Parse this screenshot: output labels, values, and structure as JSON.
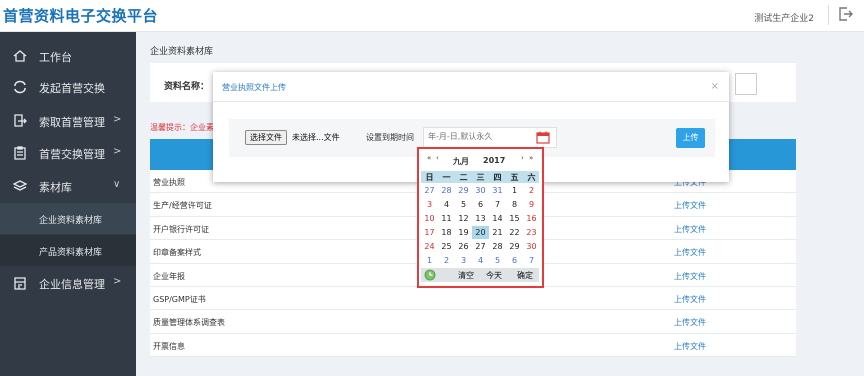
{
  "header": {
    "title": "首营资料电子交换平台",
    "user": "测试生产企业2"
  },
  "sidebar": {
    "items": [
      {
        "label": "工作台",
        "icon": "home-icon"
      },
      {
        "label": "发起首营交换",
        "icon": "exchange-icon"
      },
      {
        "label": "索取首营管理",
        "icon": "request-icon",
        "chevron": ">"
      },
      {
        "label": "首营交换管理",
        "icon": "clipboard-icon",
        "chevron": ">"
      },
      {
        "label": "素材库",
        "icon": "layers-icon",
        "chevron": "∨"
      },
      {
        "label": "企业资料素材库",
        "sub": true
      },
      {
        "label": "产品资料素材库",
        "sub": true
      },
      {
        "label": "企业信息管理",
        "icon": "building-icon",
        "chevron": ">"
      }
    ]
  },
  "main": {
    "breadcrumb": "企业资料素材库",
    "filter_label": "资料名称：",
    "hint": "温馨提示：企业素",
    "rows": [
      {
        "name": "营业执照",
        "action": "上传文件"
      },
      {
        "name": "生产/经营许可证",
        "action": "上传文件"
      },
      {
        "name": "开户银行许可证",
        "action": "上传文件"
      },
      {
        "name": "印章备案样式",
        "action": "上传文件"
      },
      {
        "name": "企业年报",
        "action": "上传文件"
      },
      {
        "name": "GSP/GMP证书",
        "action": "上传文件"
      },
      {
        "name": "质量管理体系调查表",
        "action": "上传文件"
      },
      {
        "name": "开票信息",
        "action": "上传文件"
      }
    ]
  },
  "modal": {
    "title": "营业执照文件上传",
    "close": "×",
    "file_button": "选择文件",
    "file_status": "未选择...文件",
    "expire_label": "设置到期时间",
    "date_placeholder": "年-月-日,默认永久",
    "upload_button": "上传"
  },
  "calendar": {
    "month": "九月",
    "year": "2017",
    "nav": [
      "«",
      "‹",
      "›",
      "»"
    ],
    "weekdays": [
      "日",
      "一",
      "二",
      "三",
      "四",
      "五",
      "六"
    ],
    "weeks": [
      [
        "27",
        "28",
        "29",
        "30",
        "31",
        "1",
        "2"
      ],
      [
        "3",
        "4",
        "5",
        "6",
        "7",
        "8",
        "9"
      ],
      [
        "10",
        "11",
        "12",
        "13",
        "14",
        "15",
        "16"
      ],
      [
        "17",
        "18",
        "19",
        "20",
        "21",
        "22",
        "23"
      ],
      [
        "24",
        "25",
        "26",
        "27",
        "28",
        "29",
        "30"
      ],
      [
        "1",
        "2",
        "3",
        "4",
        "5",
        "6",
        "7"
      ]
    ],
    "today": "20",
    "footer": [
      "清空",
      "今天",
      "确定"
    ]
  },
  "colors": {
    "brand": "#1a73b8",
    "sidebar_bg": "#323a45",
    "table_header": "#2897d8",
    "upload_button": "#2ea3e8",
    "highlight_border": "#e23c3c"
  }
}
